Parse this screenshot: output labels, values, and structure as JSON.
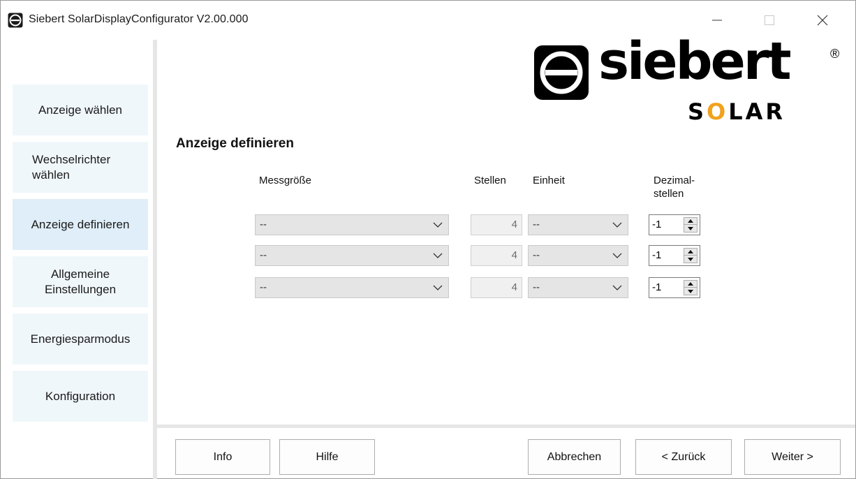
{
  "window": {
    "title": "Siebert SolarDisplayConfigurator V2.00.000"
  },
  "sidebar": {
    "items": [
      {
        "label": "Anzeige wählen"
      },
      {
        "label": "Wechselrichter\nwählen"
      },
      {
        "label": "Anzeige definieren",
        "active": true
      },
      {
        "label": "Allgemeine\nEinstellungen"
      },
      {
        "label": "Energiesparmodus"
      },
      {
        "label": "Konfiguration"
      }
    ]
  },
  "logo": {
    "word": "siebert",
    "registered": "®",
    "solar_prefix": "S",
    "solar_o": "O",
    "solar_suffix": "LAR",
    "accent_color": "#f0a21e"
  },
  "main": {
    "title": "Anzeige definieren",
    "columns": {
      "messgroesse": "Messgröße",
      "stellen": "Stellen",
      "einheit": "Einheit",
      "dezimalstellen": "Dezimal-\nstellen"
    },
    "rows": [
      {
        "messgroesse": "--",
        "stellen": "4",
        "einheit": "--",
        "dezimal": "-1"
      },
      {
        "messgroesse": "--",
        "stellen": "4",
        "einheit": "--",
        "dezimal": "-1"
      },
      {
        "messgroesse": "--",
        "stellen": "4",
        "einheit": "--",
        "dezimal": "-1"
      }
    ]
  },
  "footer": {
    "info": "Info",
    "hilfe": "Hilfe",
    "abbrechen": "Abbrechen",
    "zurueck": "< Zurück",
    "weiter": "Weiter >"
  }
}
